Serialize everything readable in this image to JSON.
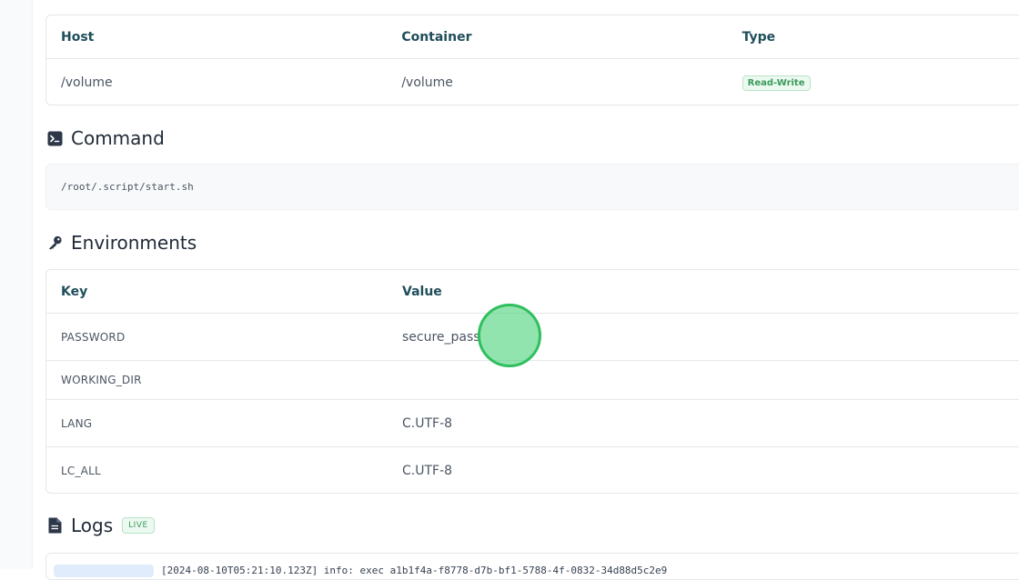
{
  "volumes": {
    "headers": [
      "Host",
      "Container",
      "Type"
    ],
    "rows": [
      {
        "host": "/volume",
        "container": "/volume",
        "type": "Read-Write"
      }
    ]
  },
  "command": {
    "title": "Command",
    "icon": "terminal-icon",
    "value": "/root/.script/start.sh"
  },
  "environments": {
    "title": "Environments",
    "icon": "key-icon",
    "headers": [
      "Key",
      "Value"
    ],
    "rows": [
      {
        "key": "PASSWORD",
        "value": "secure_pass"
      },
      {
        "key": "WORKING_DIR",
        "value": ""
      },
      {
        "key": "LANG",
        "value": "C.UTF-8"
      },
      {
        "key": "LC_ALL",
        "value": "C.UTF-8"
      }
    ]
  },
  "logs": {
    "title": "Logs",
    "icon": "document-icon",
    "badge": "LIVE",
    "first_line": "[2024-08-10T05:21:10.123Z] info: exec   a1b1f4a-f8778-d7b-bf1-5788-4f-0832-34d88d5c2e9"
  },
  "colors": {
    "accent_green": "#3a9b5c",
    "header_text": "#1f4e5a"
  }
}
